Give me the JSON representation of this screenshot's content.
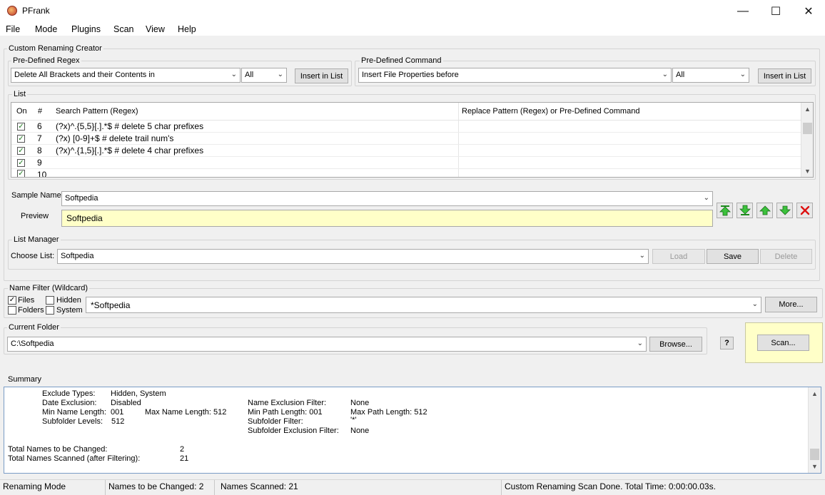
{
  "window": {
    "title": "PFrank"
  },
  "menu": [
    "File",
    "Mode",
    "Plugins",
    "Scan",
    "View",
    "Help"
  ],
  "creator": {
    "title": "Custom Renaming Creator",
    "regex_label": "Pre-Defined Regex",
    "regex_value": "Delete All Brackets and their Contents in",
    "regex_scope": "All",
    "regex_insert": "Insert in List",
    "command_label": "Pre-Defined Command",
    "command_value": "Insert File Properties before",
    "command_scope": "All",
    "command_insert": "Insert in List"
  },
  "list": {
    "title": "List",
    "headers": {
      "on": "On",
      "num": "#",
      "search": "Search Pattern (Regex)",
      "replace": "Replace Pattern (Regex)  or  Pre-Defined Command"
    },
    "rows": [
      {
        "num": "6",
        "search": "(?x)^.{5,5}[.].*$  # delete 5 char prefixes"
      },
      {
        "num": "7",
        "search": "(?x) [0-9]+$    # delete trail num's"
      },
      {
        "num": "8",
        "search": "(?x)^.{1,5}[.].*$  # delete 4 char prefixes"
      },
      {
        "num": "9",
        "search": ""
      },
      {
        "num": "10",
        "search": ""
      }
    ]
  },
  "sample": {
    "label": "Sample Name",
    "value": "Softpedia",
    "preview_label": "Preview",
    "preview_value": "Softpedia"
  },
  "list_manager": {
    "title": "List Manager",
    "choose_label": "Choose List:",
    "value": "Softpedia",
    "load": "Load",
    "save": "Save",
    "delete": "Delete"
  },
  "name_filter": {
    "title": "Name Filter (Wildcard)",
    "files": "Files",
    "hidden": "Hidden",
    "folders": "Folders",
    "system": "System",
    "value": "*Softpedia",
    "more": "More..."
  },
  "folder": {
    "title": "Current Folder",
    "value": "C:\\Softpedia",
    "browse": "Browse...",
    "help": "?",
    "scan": "Scan..."
  },
  "summary": {
    "title": "Summary",
    "exclude_types_label": "Exclude Types:",
    "exclude_types": "Hidden, System",
    "date_exclusion_label": "Date Exclusion:",
    "date_exclusion": "Disabled",
    "min_name_label": "Min Name Length:",
    "min_name": "001",
    "max_name_label": "Max Name Length:",
    "max_name": "512",
    "subfolder_levels_label": "Subfolder Levels:",
    "subfolder_levels": "512",
    "name_excl_label": "Name Exclusion Filter:",
    "name_excl": "None",
    "min_path_label": "Min Path Length: 001",
    "max_path_label": "Max Path Length: 512",
    "subfolder_filter_label": "Subfolder Filter:",
    "subfolder_filter": "'*'",
    "subfolder_excl_label": "Subfolder Exclusion Filter:",
    "subfolder_excl": "None",
    "total_changed_label": "Total Names to be Changed:",
    "total_changed": "2",
    "total_scanned_label": "Total Names Scanned (after Filtering):",
    "total_scanned": "21"
  },
  "status": {
    "mode": "Renaming Mode",
    "changed": "Names to be Changed: 2",
    "scanned": "Names Scanned: 21",
    "message": "Custom Renaming Scan Done.  Total Time: 0:00:00.03s."
  }
}
